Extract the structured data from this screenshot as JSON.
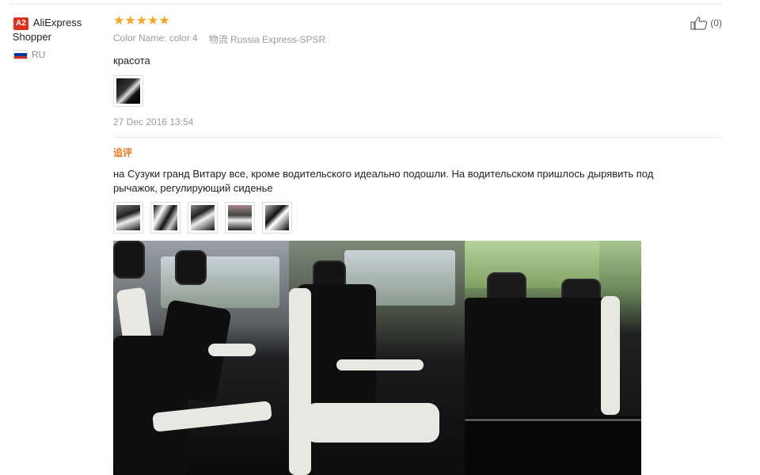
{
  "user": {
    "badge": "A2",
    "name_line1": "AliExpress",
    "name_line2": "Shopper",
    "country": "RU",
    "flag_colors": [
      "#ffffff",
      "#0039a6",
      "#d52b1e"
    ]
  },
  "review": {
    "stars": "★★★★★",
    "rating": 5,
    "star_color": "#f5a623",
    "color_label": "Color Name:",
    "color_value": "color 4",
    "logistics_label": "物流",
    "logistics_value": "Russia Express-SPSR",
    "text": "красота",
    "date": "27 Dec 2016 13:54"
  },
  "append": {
    "label": "追评",
    "label_color": "#e8791e",
    "text": "на Сузуки гранд Витару все, кроме водительского идеально подошли. На водительском пришлось дырявить под рычажок, регулирующий сиденье",
    "thumbnail_count": 5
  },
  "helpful": {
    "icon": "thumbs-up-icon",
    "count": "(0)"
  },
  "photos": {
    "count": 3
  }
}
